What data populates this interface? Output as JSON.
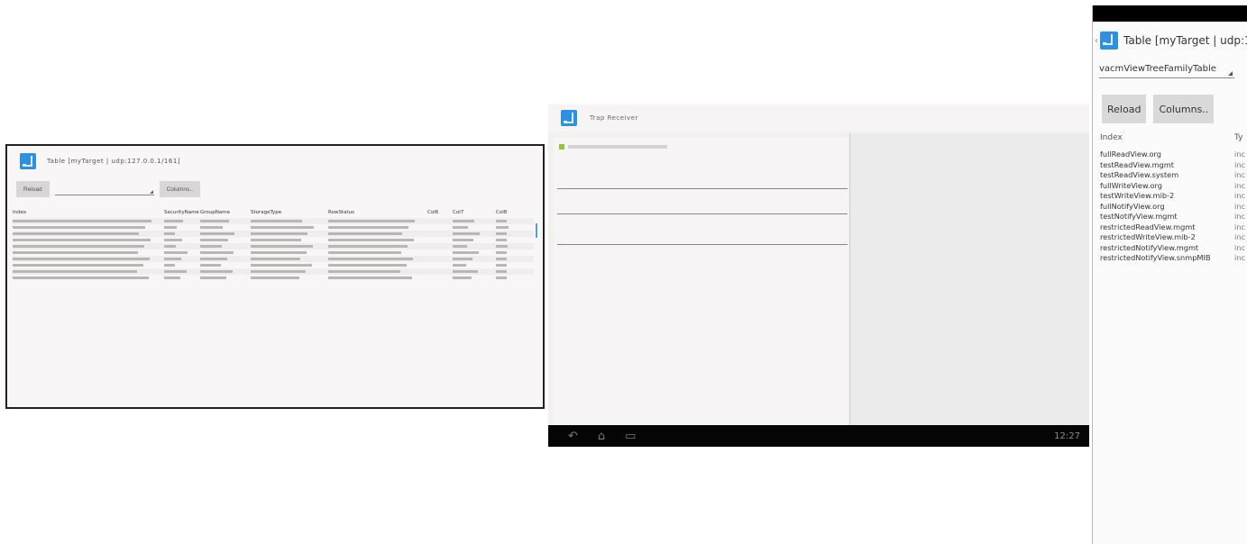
{
  "phone": {
    "title": "Table [myTarget | udp:1",
    "table_select": "vacmViewTreeFamilyTable",
    "reload_label": "Reload",
    "columns_label": "Columns..",
    "col_index": "Index",
    "col_type": "Ty",
    "rows": [
      {
        "index": "fullReadView.org",
        "type": "inc"
      },
      {
        "index": "testReadView.mgmt",
        "type": "inc"
      },
      {
        "index": "testReadView.system",
        "type": "inc"
      },
      {
        "index": "fullWriteView.org",
        "type": "inc"
      },
      {
        "index": "testWriteView.mib-2",
        "type": "inc"
      },
      {
        "index": "fullNotifyView.org",
        "type": "inc"
      },
      {
        "index": "testNotifyView.mgmt",
        "type": "inc"
      },
      {
        "index": "restrictedReadView.mgmt",
        "type": "inc"
      },
      {
        "index": "restrictedWriteView.mib-2",
        "type": "inc"
      },
      {
        "index": "restrictedNotifyView.mgmt",
        "type": "inc"
      },
      {
        "index": "restrictedNotifyView.snmpMIB",
        "type": "inc"
      }
    ]
  },
  "tablet_a": {
    "title": "Table [myTarget | udp:127.0.0.1/161]",
    "reload_label": "Reload",
    "columns_label": "Columns..",
    "columns": [
      "Index",
      "SecurityName",
      "GroupName",
      "StorageType",
      "RowStatus",
      "Col6",
      "Col7",
      "Col8"
    ],
    "row_count": 10
  },
  "tablet_b": {
    "title": "Trap Receiver",
    "clock": "12:27"
  }
}
